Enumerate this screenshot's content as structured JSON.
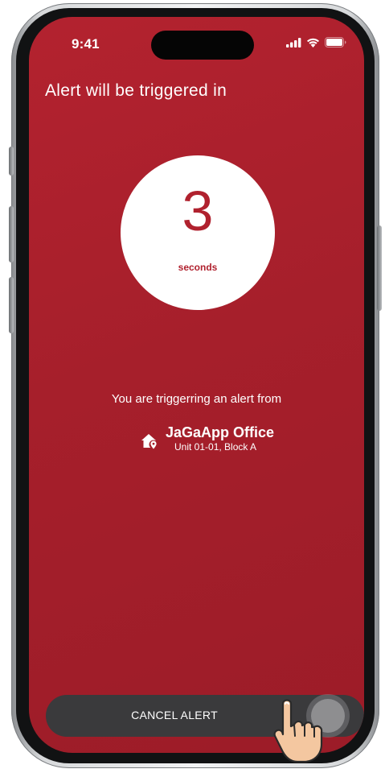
{
  "status_bar": {
    "time": "9:41",
    "icons": [
      "cellular-signal-icon",
      "wifi-icon",
      "battery-icon"
    ]
  },
  "alert": {
    "title": "Alert will be triggered in",
    "countdown_value": "3",
    "countdown_unit": "seconds"
  },
  "location": {
    "intro": "You are triggerring an alert from",
    "icon": "home-location-icon",
    "name": "JaGaApp Office",
    "address": "Unit 01-01, Block A"
  },
  "cancel": {
    "label": "CANCEL ALERT",
    "handle_icon": "slider-knob",
    "pointer_icon": "hand-pointer-icon"
  },
  "colors": {
    "alert_background": "#a61f2b",
    "countdown_text": "#b0212e",
    "cancel_bar": "#3a3a3c"
  }
}
